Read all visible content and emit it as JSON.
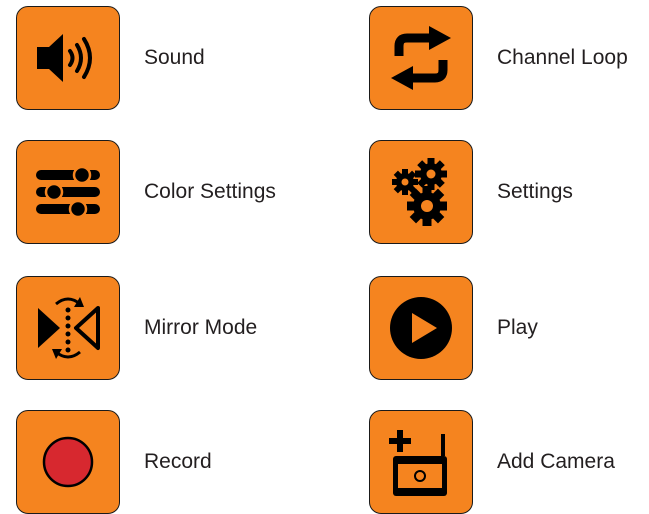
{
  "accent_color": "#f5841f",
  "items": [
    {
      "label": "Sound",
      "icon": "speaker-sound-icon"
    },
    {
      "label": "Channel Loop",
      "icon": "channel-loop-icon"
    },
    {
      "label": "Color Settings",
      "icon": "sliders-icon"
    },
    {
      "label": "Settings",
      "icon": "gears-icon"
    },
    {
      "label": "Mirror Mode",
      "icon": "mirror-mode-icon"
    },
    {
      "label": "Play",
      "icon": "play-icon"
    },
    {
      "label": "Record",
      "icon": "record-icon"
    },
    {
      "label": "Add Camera",
      "icon": "add-camera-icon"
    }
  ]
}
